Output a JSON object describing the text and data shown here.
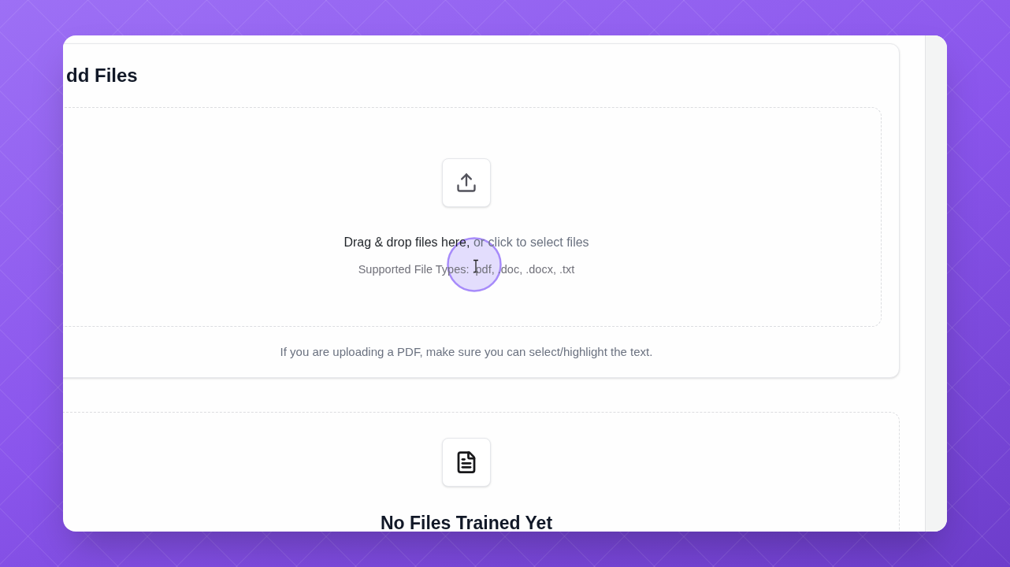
{
  "upload_card": {
    "title": "dd Files",
    "dropzone": {
      "prompt": "Drag & drop files here,",
      "link": "or click to select files",
      "supported_types": "Supported File Types: .pdf, .doc, .docx, .txt"
    },
    "note": "If you are uploading a PDF, make sure you can select/highlight the text."
  },
  "trained_files": {
    "title": "No Files Trained Yet"
  }
}
